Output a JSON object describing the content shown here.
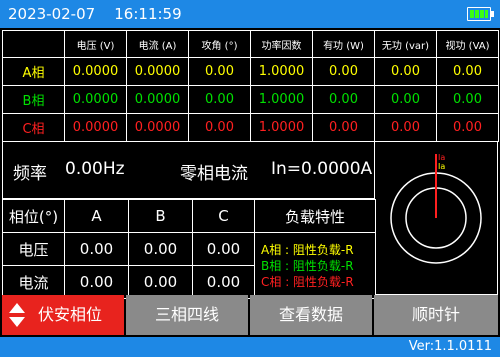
{
  "status": {
    "date": "2023-02-07",
    "time": "16:11:59",
    "battery_icon": "battery-full-icon",
    "battery_color": "#39FF14"
  },
  "power_table": {
    "headers": [
      "",
      "电压 (V)",
      "电流 (A)",
      "攻角 (°)",
      "功率因数",
      "有功 (W)",
      "无功 (var)",
      "视功 (VA)"
    ],
    "rows": [
      {
        "phase": "A相",
        "color": "#FFFF00",
        "values": [
          "0.0000",
          "0.0000",
          "0.00",
          "1.0000",
          "0.00",
          "0.00",
          "0.00"
        ]
      },
      {
        "phase": "B相",
        "color": "#00E000",
        "values": [
          "0.0000",
          "0.0000",
          "0.00",
          "1.0000",
          "0.00",
          "0.00",
          "0.00"
        ]
      },
      {
        "phase": "C相",
        "color": "#FF2020",
        "values": [
          "0.0000",
          "0.0000",
          "0.00",
          "1.0000",
          "0.00",
          "0.00",
          "0.00"
        ]
      }
    ]
  },
  "frequency": {
    "label": "频率",
    "value": "0.00Hz"
  },
  "zero_current": {
    "label": "零相电流",
    "value": "In=0.0000A"
  },
  "phase_table": {
    "header": [
      "相位(°)",
      "A",
      "B",
      "C"
    ],
    "load_title": "负载特性",
    "rows": [
      {
        "label": "电压",
        "values": [
          "0.00",
          "0.00",
          "0.00"
        ]
      },
      {
        "label": "电流",
        "values": [
          "0.00",
          "0.00",
          "0.00"
        ]
      }
    ],
    "load_lines": [
      {
        "text": "A相 : 阻性负载-R",
        "color": "#FFFF00"
      },
      {
        "text": "B相 : 阻性负载-R",
        "color": "#00E000"
      },
      {
        "text": "C相 : 阻性负载-R",
        "color": "#FF2020"
      }
    ]
  },
  "phasor": {
    "labels": [
      "Ia",
      "Ia"
    ],
    "line_color": "#FF2020",
    "ring_color": "#FFFFFF"
  },
  "buttons": {
    "voltamp": "伏安相位",
    "wiring": "三相四线",
    "data": "查看数据",
    "rotation": "顺时针",
    "active_color": "#E8231E",
    "inactive_color": "#8A8A8A"
  },
  "version": "Ver:1.1.0111",
  "colors": {
    "bar": "#1E88E5",
    "background": "#000000"
  }
}
